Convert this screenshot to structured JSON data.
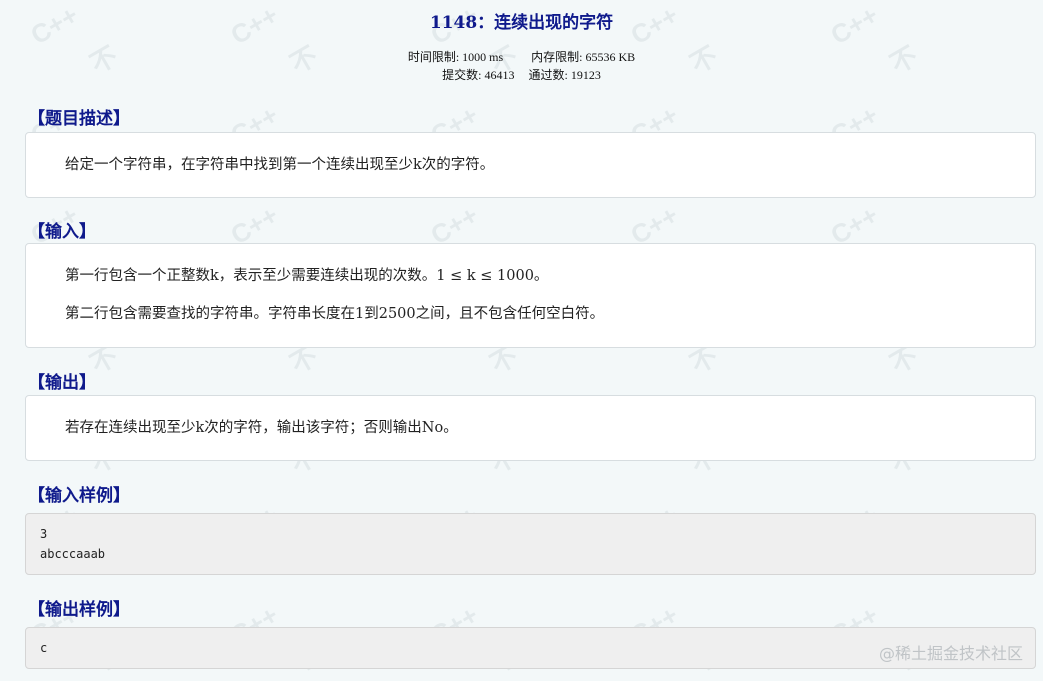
{
  "problem": {
    "title": "1148：连续出现的字符",
    "time_limit": "时间限制: 1000 ms",
    "memory_limit": "内存限制: 65536 KB",
    "submissions": "提交数: 46413",
    "accepted": "通过数: 19123"
  },
  "sections": {
    "description": {
      "heading": "【题目描述】",
      "text": "给定一个字符串，在字符串中找到第一个连续出现至少k次的字符。"
    },
    "input": {
      "heading": "【输入】",
      "line1": "第一行包含一个正整数k，表示至少需要连续出现的次数。1 ≤ k ≤ 1000。",
      "line2": "第二行包含需要查找的字符串。字符串长度在1到2500之间，且不包含任何空白符。"
    },
    "output": {
      "heading": "【输出】",
      "text": "若存在连续出现至少k次的字符，输出该字符；否则输出No。"
    },
    "sample_input": {
      "heading": "【输入样例】",
      "code": "3\nabcccaaab"
    },
    "sample_output": {
      "heading": "【输出样例】",
      "code": "c"
    }
  },
  "watermark": {
    "text": "C++",
    "mark": "不"
  },
  "credit": "@稀土掘金技术社区"
}
